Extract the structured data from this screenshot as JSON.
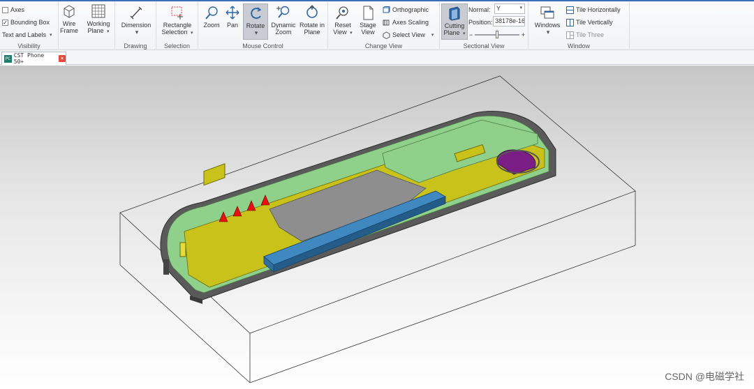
{
  "ribbon": {
    "visibility": {
      "label": "Visibility",
      "axes": {
        "label": "Axes",
        "checked": false
      },
      "bounding_box": {
        "label": "Bounding Box",
        "checked": true
      },
      "text_and_labels": {
        "label": "Text and Labels"
      }
    },
    "wire_frame": {
      "line1": "Wire",
      "line2": "Frame"
    },
    "working_plane": {
      "line1": "Working",
      "line2": "Plane"
    },
    "drawing": {
      "label": "Drawing",
      "dimension": "Dimension"
    },
    "selection": {
      "label": "Selection",
      "line1": "Rectangle",
      "line2": "Selection"
    },
    "mouse_control": {
      "label": "Mouse Control",
      "zoom": "Zoom",
      "pan": "Pan",
      "rotate": "Rotate",
      "dynamic_zoom": {
        "line1": "Dynamic",
        "line2": "Zoom"
      },
      "rotate_in_plane": {
        "line1": "Rotate in",
        "line2": "Plane"
      }
    },
    "change_view": {
      "label": "Change View",
      "reset_view": {
        "line1": "Reset",
        "line2": "View"
      },
      "stage_view": {
        "line1": "Stage",
        "line2": "View"
      },
      "orthographic": "Orthographic",
      "axes_scaling": "Axes Scaling",
      "select_view": "Select View"
    },
    "sectional_view": {
      "label": "Sectional View",
      "cutting_plane": {
        "line1": "Cutting",
        "line2": "Plane"
      },
      "normal_label": "Normal:",
      "normal_value": "Y",
      "position_label": "Position:",
      "position_value": "38178e-16",
      "slider_minus": "−",
      "slider_plus": "+",
      "slider_level": 0.5
    },
    "window": {
      "label": "Window",
      "windows": "Windows",
      "tile_horizontally": "Tile Horizontally",
      "tile_vertically": "Tile Vertically",
      "tile_three": "Tile Three"
    }
  },
  "document_tab": {
    "icon_text": "PC",
    "title": "CST Phone 50+",
    "close": "×"
  },
  "watermark": "CSDN @电磁学社",
  "colors": {
    "accent": "#3b6fb4",
    "model_green": "#8fd08a",
    "model_yellow": "#c8c21a",
    "model_gray": "#8e8e8e",
    "model_blue": "#2f6fa0",
    "model_purple": "#7a1e86",
    "port_red": "#e81010"
  }
}
